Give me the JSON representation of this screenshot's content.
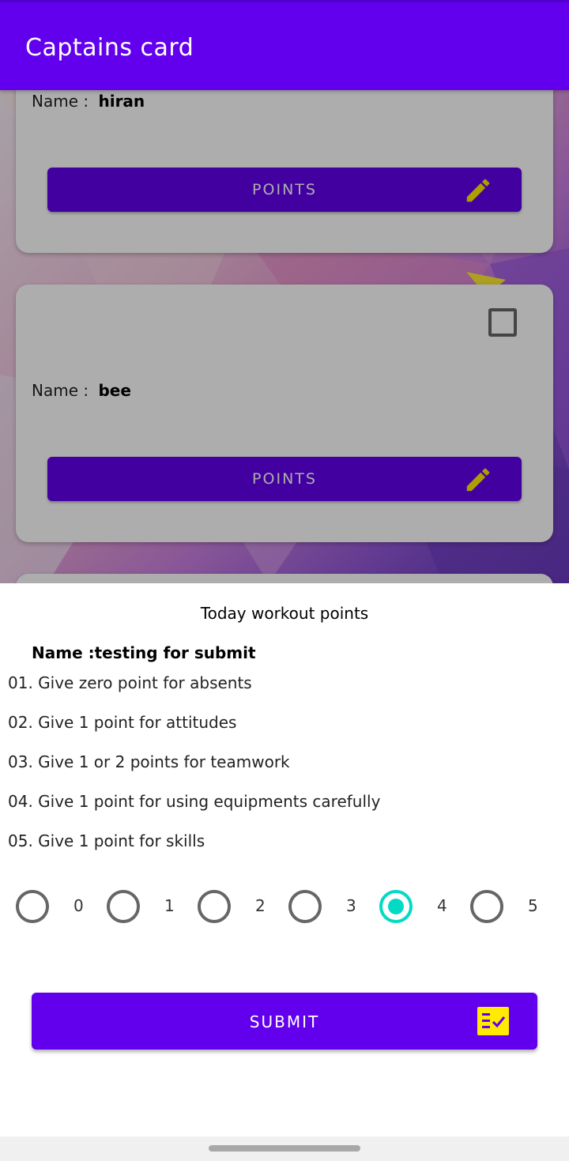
{
  "appbar": {
    "title": "Captains card"
  },
  "cards": [
    {
      "name_label": "Name :",
      "name_value": "hiran",
      "button_label": "POINTS"
    },
    {
      "name_label": "Name :",
      "name_value": "bee",
      "button_label": "POINTS"
    }
  ],
  "sheet": {
    "title": "Today workout points",
    "name": "Name :testing for submit",
    "rules": [
      "01. Give zero point for absents",
      "02. Give 1 point for attitudes",
      "03. Give 1 or 2 points for teamwork",
      "04. Give 1 point for using equipments carefully",
      "05. Give 1 point for skills"
    ],
    "options": [
      "0",
      "1",
      "2",
      "3",
      "4",
      "5"
    ],
    "selected_option": "4",
    "submit_label": "SUBMIT"
  },
  "colors": {
    "primary": "#6200ee",
    "accent": "#03dac5",
    "icon_yellow": "#ffeb00"
  },
  "icons": {
    "edit": "pencil-icon",
    "submit": "checklist-icon"
  }
}
